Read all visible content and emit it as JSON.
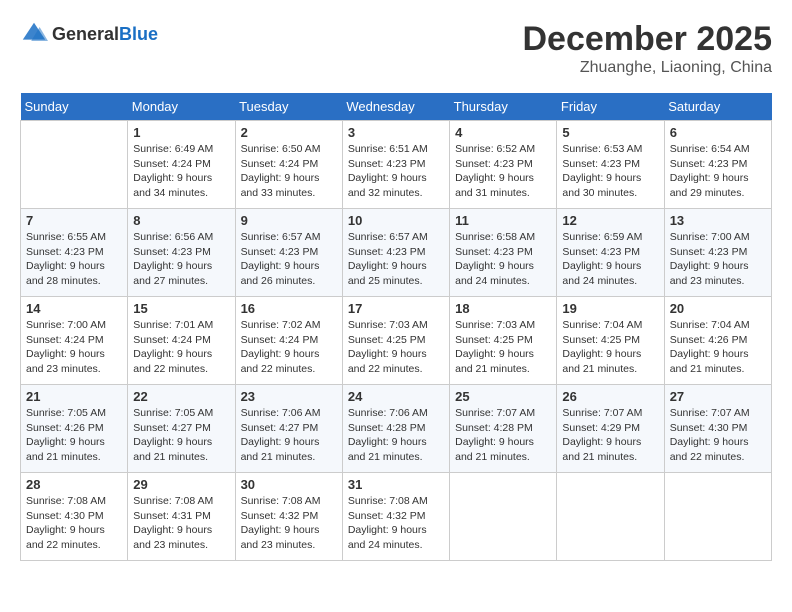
{
  "header": {
    "logo_general": "General",
    "logo_blue": "Blue",
    "month": "December 2025",
    "location": "Zhuanghe, Liaoning, China"
  },
  "days_of_week": [
    "Sunday",
    "Monday",
    "Tuesday",
    "Wednesday",
    "Thursday",
    "Friday",
    "Saturday"
  ],
  "weeks": [
    [
      {
        "day": "",
        "sunrise": "",
        "sunset": "",
        "daylight": ""
      },
      {
        "day": "1",
        "sunrise": "Sunrise: 6:49 AM",
        "sunset": "Sunset: 4:24 PM",
        "daylight": "Daylight: 9 hours and 34 minutes."
      },
      {
        "day": "2",
        "sunrise": "Sunrise: 6:50 AM",
        "sunset": "Sunset: 4:24 PM",
        "daylight": "Daylight: 9 hours and 33 minutes."
      },
      {
        "day": "3",
        "sunrise": "Sunrise: 6:51 AM",
        "sunset": "Sunset: 4:23 PM",
        "daylight": "Daylight: 9 hours and 32 minutes."
      },
      {
        "day": "4",
        "sunrise": "Sunrise: 6:52 AM",
        "sunset": "Sunset: 4:23 PM",
        "daylight": "Daylight: 9 hours and 31 minutes."
      },
      {
        "day": "5",
        "sunrise": "Sunrise: 6:53 AM",
        "sunset": "Sunset: 4:23 PM",
        "daylight": "Daylight: 9 hours and 30 minutes."
      },
      {
        "day": "6",
        "sunrise": "Sunrise: 6:54 AM",
        "sunset": "Sunset: 4:23 PM",
        "daylight": "Daylight: 9 hours and 29 minutes."
      }
    ],
    [
      {
        "day": "7",
        "sunrise": "Sunrise: 6:55 AM",
        "sunset": "Sunset: 4:23 PM",
        "daylight": "Daylight: 9 hours and 28 minutes."
      },
      {
        "day": "8",
        "sunrise": "Sunrise: 6:56 AM",
        "sunset": "Sunset: 4:23 PM",
        "daylight": "Daylight: 9 hours and 27 minutes."
      },
      {
        "day": "9",
        "sunrise": "Sunrise: 6:57 AM",
        "sunset": "Sunset: 4:23 PM",
        "daylight": "Daylight: 9 hours and 26 minutes."
      },
      {
        "day": "10",
        "sunrise": "Sunrise: 6:57 AM",
        "sunset": "Sunset: 4:23 PM",
        "daylight": "Daylight: 9 hours and 25 minutes."
      },
      {
        "day": "11",
        "sunrise": "Sunrise: 6:58 AM",
        "sunset": "Sunset: 4:23 PM",
        "daylight": "Daylight: 9 hours and 24 minutes."
      },
      {
        "day": "12",
        "sunrise": "Sunrise: 6:59 AM",
        "sunset": "Sunset: 4:23 PM",
        "daylight": "Daylight: 9 hours and 24 minutes."
      },
      {
        "day": "13",
        "sunrise": "Sunrise: 7:00 AM",
        "sunset": "Sunset: 4:23 PM",
        "daylight": "Daylight: 9 hours and 23 minutes."
      }
    ],
    [
      {
        "day": "14",
        "sunrise": "Sunrise: 7:00 AM",
        "sunset": "Sunset: 4:24 PM",
        "daylight": "Daylight: 9 hours and 23 minutes."
      },
      {
        "day": "15",
        "sunrise": "Sunrise: 7:01 AM",
        "sunset": "Sunset: 4:24 PM",
        "daylight": "Daylight: 9 hours and 22 minutes."
      },
      {
        "day": "16",
        "sunrise": "Sunrise: 7:02 AM",
        "sunset": "Sunset: 4:24 PM",
        "daylight": "Daylight: 9 hours and 22 minutes."
      },
      {
        "day": "17",
        "sunrise": "Sunrise: 7:03 AM",
        "sunset": "Sunset: 4:25 PM",
        "daylight": "Daylight: 9 hours and 22 minutes."
      },
      {
        "day": "18",
        "sunrise": "Sunrise: 7:03 AM",
        "sunset": "Sunset: 4:25 PM",
        "daylight": "Daylight: 9 hours and 21 minutes."
      },
      {
        "day": "19",
        "sunrise": "Sunrise: 7:04 AM",
        "sunset": "Sunset: 4:25 PM",
        "daylight": "Daylight: 9 hours and 21 minutes."
      },
      {
        "day": "20",
        "sunrise": "Sunrise: 7:04 AM",
        "sunset": "Sunset: 4:26 PM",
        "daylight": "Daylight: 9 hours and 21 minutes."
      }
    ],
    [
      {
        "day": "21",
        "sunrise": "Sunrise: 7:05 AM",
        "sunset": "Sunset: 4:26 PM",
        "daylight": "Daylight: 9 hours and 21 minutes."
      },
      {
        "day": "22",
        "sunrise": "Sunrise: 7:05 AM",
        "sunset": "Sunset: 4:27 PM",
        "daylight": "Daylight: 9 hours and 21 minutes."
      },
      {
        "day": "23",
        "sunrise": "Sunrise: 7:06 AM",
        "sunset": "Sunset: 4:27 PM",
        "daylight": "Daylight: 9 hours and 21 minutes."
      },
      {
        "day": "24",
        "sunrise": "Sunrise: 7:06 AM",
        "sunset": "Sunset: 4:28 PM",
        "daylight": "Daylight: 9 hours and 21 minutes."
      },
      {
        "day": "25",
        "sunrise": "Sunrise: 7:07 AM",
        "sunset": "Sunset: 4:28 PM",
        "daylight": "Daylight: 9 hours and 21 minutes."
      },
      {
        "day": "26",
        "sunrise": "Sunrise: 7:07 AM",
        "sunset": "Sunset: 4:29 PM",
        "daylight": "Daylight: 9 hours and 21 minutes."
      },
      {
        "day": "27",
        "sunrise": "Sunrise: 7:07 AM",
        "sunset": "Sunset: 4:30 PM",
        "daylight": "Daylight: 9 hours and 22 minutes."
      }
    ],
    [
      {
        "day": "28",
        "sunrise": "Sunrise: 7:08 AM",
        "sunset": "Sunset: 4:30 PM",
        "daylight": "Daylight: 9 hours and 22 minutes."
      },
      {
        "day": "29",
        "sunrise": "Sunrise: 7:08 AM",
        "sunset": "Sunset: 4:31 PM",
        "daylight": "Daylight: 9 hours and 23 minutes."
      },
      {
        "day": "30",
        "sunrise": "Sunrise: 7:08 AM",
        "sunset": "Sunset: 4:32 PM",
        "daylight": "Daylight: 9 hours and 23 minutes."
      },
      {
        "day": "31",
        "sunrise": "Sunrise: 7:08 AM",
        "sunset": "Sunset: 4:32 PM",
        "daylight": "Daylight: 9 hours and 24 minutes."
      },
      {
        "day": "",
        "sunrise": "",
        "sunset": "",
        "daylight": ""
      },
      {
        "day": "",
        "sunrise": "",
        "sunset": "",
        "daylight": ""
      },
      {
        "day": "",
        "sunrise": "",
        "sunset": "",
        "daylight": ""
      }
    ]
  ]
}
